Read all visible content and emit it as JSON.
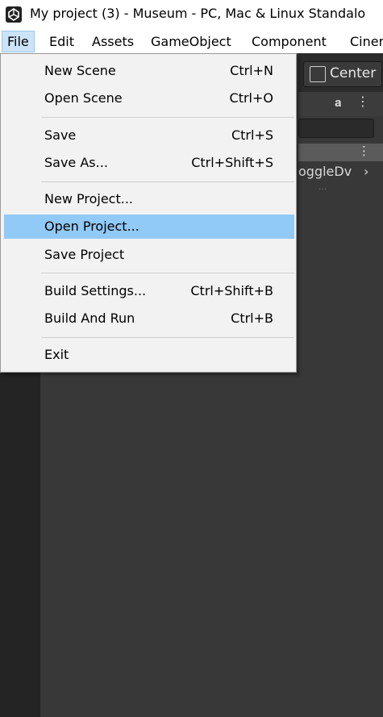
{
  "window": {
    "title": "My project (3) - Museum - PC, Mac & Linux Standalo"
  },
  "menubar": {
    "items": [
      "File",
      "Edit",
      "Assets",
      "GameObject",
      "Component",
      "Ciner"
    ],
    "active": "File"
  },
  "file_menu": {
    "items": [
      {
        "label": "New Scene",
        "shortcut": "Ctrl+N"
      },
      {
        "label": "Open Scene",
        "shortcut": "Ctrl+O"
      },
      {
        "label": "Save",
        "shortcut": "Ctrl+S"
      },
      {
        "label": "Save As...",
        "shortcut": "Ctrl+Shift+S"
      },
      {
        "label": "New Project...",
        "shortcut": ""
      },
      {
        "label": "Open Project...",
        "shortcut": ""
      },
      {
        "label": "Save Project",
        "shortcut": ""
      },
      {
        "label": "Build Settings...",
        "shortcut": "Ctrl+Shift+B"
      },
      {
        "label": "Build And Run",
        "shortcut": "Ctrl+B"
      },
      {
        "label": "Exit",
        "shortcut": ""
      }
    ],
    "highlighted": "Open Project..."
  },
  "editor": {
    "center_label": "Center",
    "hierarchy_item": "oggleDv"
  },
  "colors": {
    "menu_highlight": "#91c9f7",
    "active_menu": "#cce4f7",
    "editor_bg": "#383838"
  }
}
